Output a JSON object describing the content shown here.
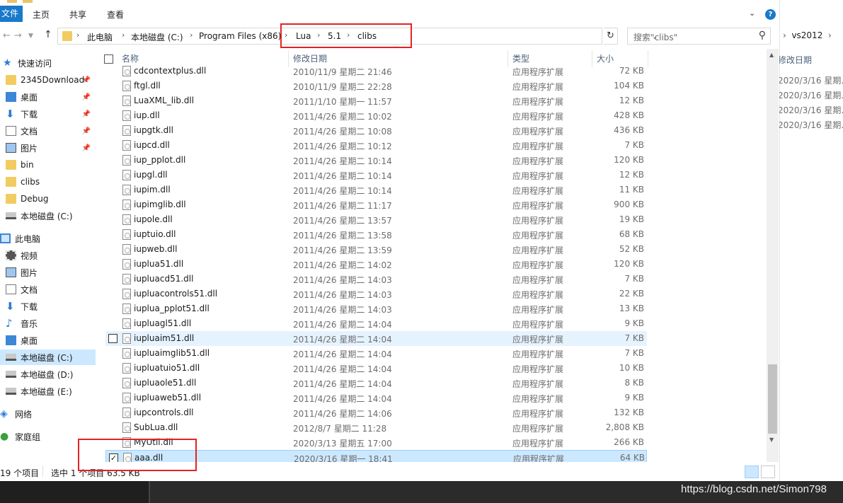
{
  "ribbon": {
    "file_tab": "文件",
    "tabs": [
      "主页",
      "共享",
      "查看"
    ],
    "help": "?"
  },
  "address": {
    "crumbs": [
      "此电脑",
      "本地磁盘 (C:)",
      "Program Files (x86)",
      "Lua",
      "5.1",
      "clibs"
    ],
    "search_placeholder": "搜索\"clibs\""
  },
  "sidebar": {
    "items": [
      {
        "label": "快速访问",
        "icon": "star-icon"
      },
      {
        "label": "2345Download",
        "icon": "folder-icon",
        "pinned": true
      },
      {
        "label": "桌面",
        "icon": "desktop-icon",
        "pinned": true
      },
      {
        "label": "下载",
        "icon": "download-icon",
        "pinned": true
      },
      {
        "label": "文档",
        "icon": "document-icon",
        "pinned": true
      },
      {
        "label": "图片",
        "icon": "picture-icon",
        "pinned": true
      },
      {
        "label": "bin",
        "icon": "folder-icon"
      },
      {
        "label": "clibs",
        "icon": "folder-icon"
      },
      {
        "label": "Debug",
        "icon": "folder-icon"
      },
      {
        "label": "本地磁盘 (C:)",
        "icon": "drive-icon"
      },
      {
        "label": "此电脑",
        "icon": "pc-icon"
      },
      {
        "label": "视频",
        "icon": "video-icon"
      },
      {
        "label": "图片",
        "icon": "picture-icon"
      },
      {
        "label": "文档",
        "icon": "document-icon"
      },
      {
        "label": "下载",
        "icon": "download-icon"
      },
      {
        "label": "音乐",
        "icon": "music-icon"
      },
      {
        "label": "桌面",
        "icon": "desktop-icon"
      },
      {
        "label": "本地磁盘 (C:)",
        "icon": "drive-icon",
        "selected": true
      },
      {
        "label": "本地磁盘 (D:)",
        "icon": "drive-icon"
      },
      {
        "label": "本地磁盘 (E:)",
        "icon": "drive-icon"
      },
      {
        "label": "网络",
        "icon": "network-icon"
      },
      {
        "label": "家庭组",
        "icon": "homegroup-icon"
      }
    ]
  },
  "columns": {
    "name": "名称",
    "date": "修改日期",
    "type": "类型",
    "size": "大小"
  },
  "files": [
    {
      "name": "cdcontextplus.dll",
      "date": "2010/11/9 星期二 21:46",
      "type": "应用程序扩展",
      "size": "72 KB"
    },
    {
      "name": "ftgl.dll",
      "date": "2010/11/9 星期二 22:28",
      "type": "应用程序扩展",
      "size": "104 KB"
    },
    {
      "name": "LuaXML_lib.dll",
      "date": "2011/1/10 星期一 11:57",
      "type": "应用程序扩展",
      "size": "12 KB"
    },
    {
      "name": "iup.dll",
      "date": "2011/4/26 星期二 10:02",
      "type": "应用程序扩展",
      "size": "428 KB"
    },
    {
      "name": "iupgtk.dll",
      "date": "2011/4/26 星期二 10:08",
      "type": "应用程序扩展",
      "size": "436 KB"
    },
    {
      "name": "iupcd.dll",
      "date": "2011/4/26 星期二 10:12",
      "type": "应用程序扩展",
      "size": "7 KB"
    },
    {
      "name": "iup_pplot.dll",
      "date": "2011/4/26 星期二 10:14",
      "type": "应用程序扩展",
      "size": "120 KB"
    },
    {
      "name": "iupgl.dll",
      "date": "2011/4/26 星期二 10:14",
      "type": "应用程序扩展",
      "size": "12 KB"
    },
    {
      "name": "iupim.dll",
      "date": "2011/4/26 星期二 10:14",
      "type": "应用程序扩展",
      "size": "11 KB"
    },
    {
      "name": "iupimglib.dll",
      "date": "2011/4/26 星期二 11:17",
      "type": "应用程序扩展",
      "size": "900 KB"
    },
    {
      "name": "iupole.dll",
      "date": "2011/4/26 星期二 13:57",
      "type": "应用程序扩展",
      "size": "19 KB"
    },
    {
      "name": "iuptuio.dll",
      "date": "2011/4/26 星期二 13:58",
      "type": "应用程序扩展",
      "size": "68 KB"
    },
    {
      "name": "iupweb.dll",
      "date": "2011/4/26 星期二 13:59",
      "type": "应用程序扩展",
      "size": "52 KB"
    },
    {
      "name": "iuplua51.dll",
      "date": "2011/4/26 星期二 14:02",
      "type": "应用程序扩展",
      "size": "120 KB"
    },
    {
      "name": "iupluacd51.dll",
      "date": "2011/4/26 星期二 14:03",
      "type": "应用程序扩展",
      "size": "7 KB"
    },
    {
      "name": "iupluacontrols51.dll",
      "date": "2011/4/26 星期二 14:03",
      "type": "应用程序扩展",
      "size": "22 KB"
    },
    {
      "name": "iuplua_pplot51.dll",
      "date": "2011/4/26 星期二 14:03",
      "type": "应用程序扩展",
      "size": "13 KB"
    },
    {
      "name": "iupluagl51.dll",
      "date": "2011/4/26 星期二 14:04",
      "type": "应用程序扩展",
      "size": "9 KB"
    },
    {
      "name": "iupluaim51.dll",
      "date": "2011/4/26 星期二 14:04",
      "type": "应用程序扩展",
      "size": "7 KB",
      "hover": true
    },
    {
      "name": "iupluaimglib51.dll",
      "date": "2011/4/26 星期二 14:04",
      "type": "应用程序扩展",
      "size": "7 KB"
    },
    {
      "name": "iupluatuio51.dll",
      "date": "2011/4/26 星期二 14:04",
      "type": "应用程序扩展",
      "size": "10 KB"
    },
    {
      "name": "iupluaole51.dll",
      "date": "2011/4/26 星期二 14:04",
      "type": "应用程序扩展",
      "size": "8 KB"
    },
    {
      "name": "iupluaweb51.dll",
      "date": "2011/4/26 星期二 14:04",
      "type": "应用程序扩展",
      "size": "9 KB"
    },
    {
      "name": "iupcontrols.dll",
      "date": "2011/4/26 星期二 14:06",
      "type": "应用程序扩展",
      "size": "132 KB"
    },
    {
      "name": "SubLua.dll",
      "date": "2012/8/7 星期二 11:28",
      "type": "应用程序扩展",
      "size": "2,808 KB"
    },
    {
      "name": "MyUtil.dll",
      "date": "2020/3/13 星期五 17:00",
      "type": "应用程序扩展",
      "size": "266 KB"
    },
    {
      "name": "aaa.dll",
      "date": "2020/3/16 星期一 18:41",
      "type": "应用程序扩展",
      "size": "64 KB",
      "selected": true
    }
  ],
  "status": {
    "count": "19 个项目",
    "selection": "选中 1 个项目 63.5 KB"
  },
  "other_window": {
    "crumb": "vs2012",
    "header": "修改日期",
    "dates": [
      "2020/3/16 星期...",
      "2020/3/16 星期...",
      "2020/3/16 星期...",
      "2020/3/16 星期..."
    ]
  },
  "watermark": "https://blog.csdn.net/Simon798",
  "colors": {
    "accent": "#1979ca",
    "selection": "#cce8ff",
    "highlight_box": "#e32323"
  }
}
